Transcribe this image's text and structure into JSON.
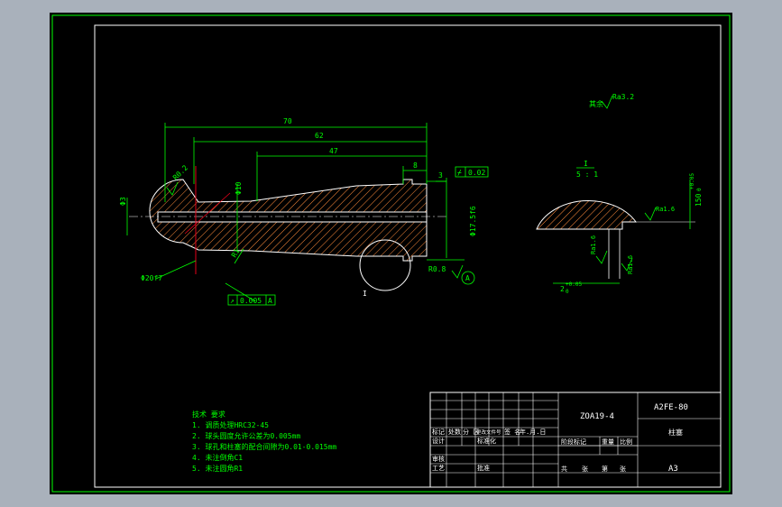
{
  "colors": {
    "background": "#000000",
    "frame": "#00ff00",
    "outline": "#ffffff",
    "hatch": "#ff8c3c",
    "center_line": "#e6001a",
    "text": "#00ff00"
  },
  "dims": {
    "d70": "70",
    "d62": "62",
    "d47": "47",
    "d8": "8",
    "d3": "3",
    "phi3": "Φ3",
    "phi10": "Φ10",
    "phi20f7": "Φ20f7",
    "phi17": "Φ17.5f6",
    "r02": "R0.2",
    "r08": "R0.8",
    "r1": "R1"
  },
  "tolerances": {
    "flatness": {
      "symbol": "⌿",
      "value": "0.02"
    },
    "runout": {
      "symbol": "↗",
      "value": "0.005",
      "datum": "A"
    }
  },
  "datum": "A",
  "roughness": {
    "other_label": "其余",
    "other_value": "Ra3.2",
    "r16": "Ra1.6"
  },
  "detail": {
    "label": "I",
    "scale_top": "I",
    "scale": "5 : 1",
    "r16_a": "Ra1.6",
    "r16_b": "Ra1.6",
    "r16_c": "Ra1.6",
    "dim_h": "150",
    "dim_h_tol_top": "+0.05",
    "dim_h_tol_bot": "0",
    "dim_w": "2",
    "dim_w_tol_top": "+0.05",
    "dim_w_tol_bot": "0"
  },
  "notes": {
    "title": "技术 要求",
    "items": [
      "1. 调质处理HRC32-45",
      "2. 球头圆度允许公差为0.005mm",
      "3. 球孔和柱塞的配合间隙为0.01-0.015mm",
      "4. 未注倒角C1",
      "5. 未注圆角R1"
    ]
  },
  "title_block": {
    "drawing_no": "ZOA19-4",
    "model": "A2FE-80",
    "part_name": "柱塞",
    "sheet_size": "A3",
    "row_labels": [
      "标记",
      "处数",
      "分 区",
      "更改文件号",
      "签 名",
      "年.月.日"
    ],
    "design": "设计",
    "standardize": "标准化",
    "stage_marks": "阶段标记",
    "weight": "重量",
    "ratio": "比例",
    "review": "审核",
    "process": "工艺",
    "approve": "批准",
    "total": "共",
    "sheet_word": "张",
    "page": "第",
    "page_word": "张"
  }
}
